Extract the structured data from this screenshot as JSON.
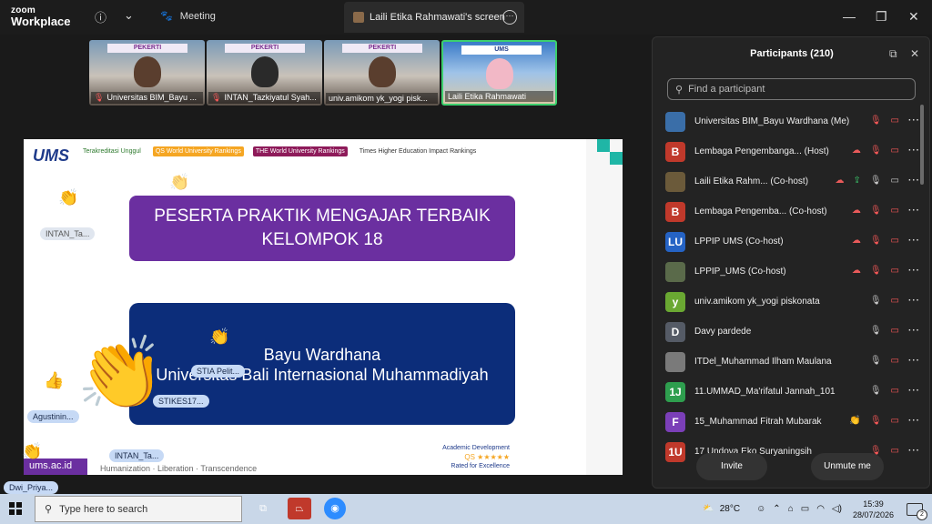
{
  "app": {
    "brand_line1": "zoom",
    "brand_line2": "Workplace",
    "meeting_label": "Meeting"
  },
  "screen_tab": {
    "label": "Laili Etika Rahmawati's screen"
  },
  "window_controls": {
    "minimize": "—",
    "maximize": "❐",
    "close": "✕"
  },
  "video_strip": [
    {
      "name": "Universitas BIM_Bayu ...",
      "banner": "PEKERTI",
      "muted": true
    },
    {
      "name": "INTAN_Tazkiyatul Syah...",
      "banner": "PEKERTI",
      "muted": true
    },
    {
      "name": "univ.amikom yk_yogi pisk...",
      "banner": "PEKERTI",
      "muted": false
    },
    {
      "name": "Laili Etika Rahmawati",
      "banner": "UMS",
      "muted": false
    }
  ],
  "slide": {
    "logo": "UMS",
    "logos": [
      "Terakreditasi Unggul",
      "QS World University Rankings",
      "THE World University Rankings",
      "Times Higher Education Impact Rankings"
    ],
    "title_line1": "PESERTA PRAKTIK MENGAJAR TERBAIK",
    "title_line2": "KELOMPOK 18",
    "winner_name": "Bayu Wardhana",
    "winner_inst": "Universitas Bali Internasional Muhammadiyah",
    "footer_url": "ums.ac.id",
    "footer_tag": "Humanization · Liberation · Transcendence",
    "acad_line1": "Academic Development",
    "acad_line2": "QS ★★★★★",
    "acad_line3": "Rated for Excellence"
  },
  "reaction_chips": [
    {
      "text": "INTAN_Ta...",
      "style": "light"
    },
    {
      "text": "STIA Pelit...",
      "style": "blue"
    },
    {
      "text": "STIKES17...",
      "style": "blue"
    },
    {
      "text": "Agustinin...",
      "style": "blue"
    },
    {
      "text": "INTAN_Ta...",
      "style": "blue"
    },
    {
      "text": "Dwi_Priya...",
      "style": "blue"
    }
  ],
  "participants_panel": {
    "title": "Participants (210)",
    "search_placeholder": "Find a participant",
    "invite_label": "Invite",
    "unmute_label": "Unmute me",
    "rows": [
      {
        "name": "Universitas BIM_Bayu Wardhana (Me)",
        "avatar": "",
        "avatar_color": "#3a6ea8",
        "icons": [
          "mute",
          "vidoff",
          "more"
        ]
      },
      {
        "name": "Lembaga Pengembanga... (Host)",
        "avatar": "B",
        "avatar_color": "#c0392b",
        "icons": [
          "cloud",
          "mute",
          "vidoff",
          "more"
        ]
      },
      {
        "name": "Laili Etika Rahm... (Co-host)",
        "avatar": "",
        "avatar_color": "#6b5a3a",
        "icons": [
          "cloud",
          "share",
          "mic",
          "vid",
          "more"
        ]
      },
      {
        "name": "Lembaga Pengemba... (Co-host)",
        "avatar": "B",
        "avatar_color": "#c0392b",
        "icons": [
          "cloud",
          "mute",
          "vidoff",
          "more"
        ]
      },
      {
        "name": "LPPIP UMS (Co-host)",
        "avatar": "LU",
        "avatar_color": "#2563c4",
        "icons": [
          "cloud",
          "mute",
          "vidoff",
          "more"
        ]
      },
      {
        "name": "LPPIP_UMS (Co-host)",
        "avatar": "",
        "avatar_color": "#5a6a4a",
        "icons": [
          "cloud",
          "mute",
          "vidoff",
          "more"
        ]
      },
      {
        "name": "univ.amikom yk_yogi piskonata",
        "avatar": "y",
        "avatar_color": "#6aa832",
        "icons": [
          "mic",
          "vidoff",
          "more"
        ]
      },
      {
        "name": "Davy pardede",
        "avatar": "D",
        "avatar_color": "#555b66",
        "icons": [
          "mic",
          "vidoff",
          "more"
        ]
      },
      {
        "name": "ITDel_Muhammad Ilham Maulana",
        "avatar": "",
        "avatar_color": "#7a7a7a",
        "icons": [
          "mic",
          "vidoff",
          "more"
        ]
      },
      {
        "name": "11.UMMAD_Ma'rifatul Jannah_101",
        "avatar": "1J",
        "avatar_color": "#2e9e4e",
        "icons": [
          "mic",
          "vidoff",
          "more"
        ]
      },
      {
        "name": "15_Muhammad Fitrah Mubarak",
        "avatar": "F",
        "avatar_color": "#7b3fb8",
        "icons": [
          "hand",
          "mute",
          "vidoff",
          "more"
        ]
      },
      {
        "name": "17 Undova Eko Suryaningsih",
        "avatar": "1U",
        "avatar_color": "#c0392b",
        "icons": [
          "mute",
          "vidoff",
          "more"
        ]
      }
    ]
  },
  "taskbar": {
    "search_placeholder": "Type here to search",
    "weather": "28°C",
    "time": "15:39",
    "date": "28/07/2026",
    "notifications": "2"
  }
}
